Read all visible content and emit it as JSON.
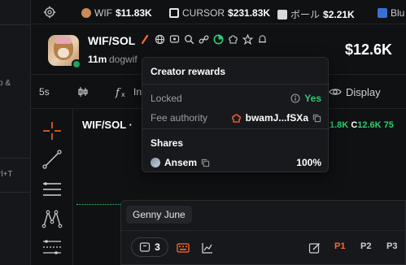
{
  "left_strip": {
    "fragments": [
      "o &",
      "rl+T"
    ]
  },
  "ticker": {
    "items": [
      {
        "name": "WIF",
        "price": "$11.83K",
        "icon": "wif-token-icon",
        "color": "#c98b57"
      },
      {
        "name": "CURSOR",
        "price": "$231.83K",
        "icon": "cursor-token-icon",
        "color": "#e6e6e6"
      },
      {
        "name": "ボール",
        "price": "$2.21K",
        "icon": "ball-token-icon",
        "color": "#d9d9d9"
      },
      {
        "name": "Blu",
        "price": "",
        "icon": "blu-token-icon",
        "color": "#3b6fd8"
      }
    ]
  },
  "token": {
    "pair": "WIF/SOL",
    "age": "11m",
    "handle": "dogwif",
    "market_cap": "$12.6K"
  },
  "toolbar": {
    "timeframe": "5s",
    "indicators_partial": "In",
    "display_label": "Display"
  },
  "chart": {
    "label": "WIF/SOL ·",
    "ohlc": {
      "h_value": "1.8K",
      "c_label": "C",
      "c_value": "12.6K",
      "extra": "75"
    }
  },
  "bottom_panel": {
    "name_tag": "Genny June",
    "count": "3",
    "pages": [
      "P1",
      "P2",
      "P3"
    ]
  },
  "popup": {
    "title": "Creator rewards",
    "locked_label": "Locked",
    "locked_value": "Yes",
    "fee_label": "Fee authority",
    "fee_value": "bwamJ...fSXa",
    "shares_title": "Shares",
    "holder_name": "Ansem",
    "holder_share": "100%"
  },
  "colors": {
    "accent_orange": "#ff6a2b",
    "green": "#2ecc71",
    "background": "#101113"
  }
}
